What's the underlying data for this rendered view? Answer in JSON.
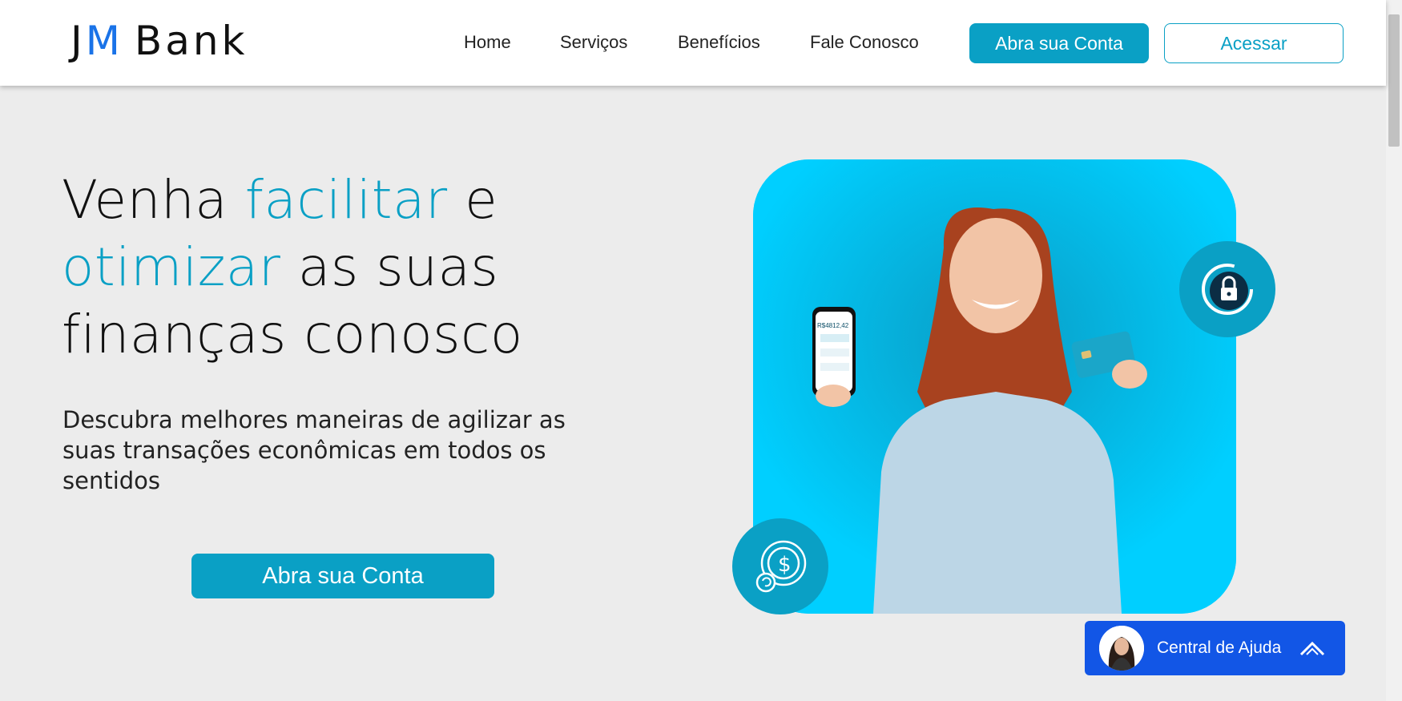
{
  "brand": {
    "logo_j": "J",
    "logo_m": "M",
    "logo_bank": "Bank"
  },
  "nav": {
    "items": [
      "Home",
      "Serviços",
      "Benefícios",
      "Fale Conosco"
    ],
    "open_account_label": "Abra sua Conta",
    "login_label": "Acessar"
  },
  "hero": {
    "line1_a": "Venha ",
    "line1_b": "facilitar",
    "line1_c": " e",
    "line2_a": "otimizar",
    "line2_b": " as suas",
    "line3": "finanças conosco",
    "subtitle": "Descubra melhores maneiras de agilizar as suas transações econômicas em todos os sentidos",
    "cta_label": "Abra sua Conta"
  },
  "phone": {
    "balance": "R$4812,42"
  },
  "help": {
    "label": "Central de Ajuda"
  },
  "colors": {
    "accent": "#0aa0c5",
    "card_bg": "#00cfff",
    "help_bg": "#1256e6"
  },
  "icons": [
    "lock-refresh-icon",
    "dollar-coins-icon",
    "chevron-up-icon"
  ]
}
